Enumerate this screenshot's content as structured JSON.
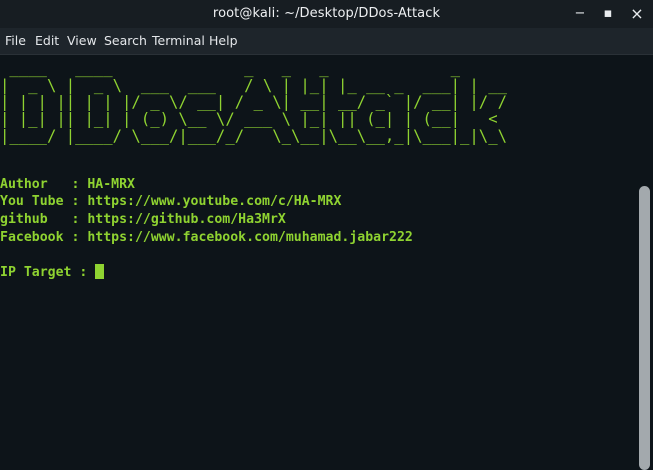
{
  "window": {
    "title": "root@kali: ~/Desktop/DDos-Attack",
    "minimize_glyph": "−",
    "maximize_glyph": "▪",
    "close_glyph": "×"
  },
  "menubar": {
    "items": [
      "File",
      "Edit",
      "View",
      "Search",
      "Terminal",
      "Help"
    ]
  },
  "terminal": {
    "banner_ascii": " ____   ____              _   _   _             _    \n|  _ \\ |  _ \\  ___  ___   / \\ | |_| |_ __ _  ___| | __\n| | | || | | |/ _ \\/ __| / _ \\| __| __/ _` |/ __| |/ /\n| |_| || |_| | (_) \\__ \\/ ___ \\ |_| || (_| | (__|   < \n|____/ |____/ \\___/|___/_/   \\_\\__|\\__\\__,_|\\___|_|\\_\\",
    "author_line": "Author   : HA-MRX",
    "youtube_line": "You Tube : https://www.youtube.com/c/HA-MRX",
    "github_line": "github   : https://github.com/Ha3MrX",
    "facebook_line": "Facebook : https://www.facebook.com/muhamad.jabar222",
    "prompt": "IP Target : ",
    "accent_color": "#8fd331",
    "background_color": "#0d1419"
  }
}
